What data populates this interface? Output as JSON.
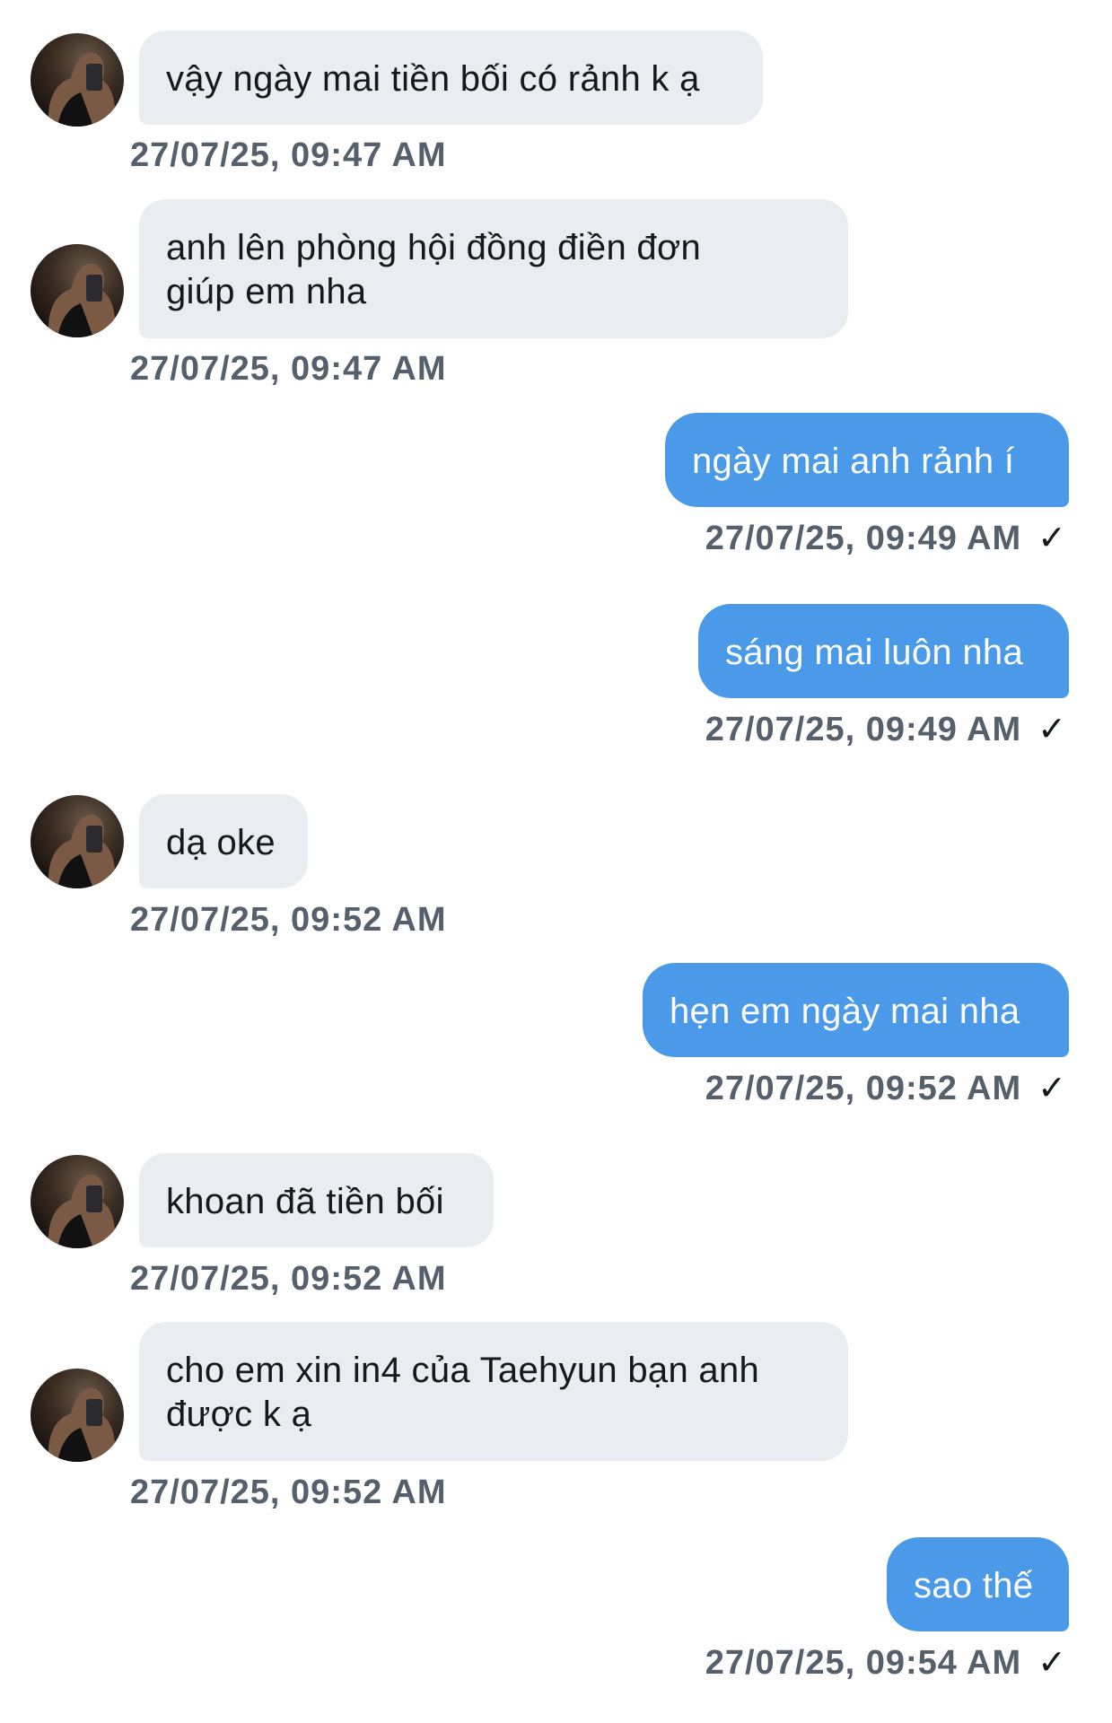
{
  "messages": [
    {
      "side": "in",
      "text": "vậy ngày mai tiền bối có rảnh k ạ",
      "time": "27/07/25, 09:47 AM"
    },
    {
      "side": "in",
      "text": "anh lên phòng hội đồng điền đơn\ngiúp em nha",
      "time": "27/07/25, 09:47 AM"
    },
    {
      "side": "out",
      "text": "ngày mai anh rảnh í",
      "time": "27/07/25, 09:49 AM",
      "status_icon": "checkmark-icon",
      "status_glyph": "✓"
    },
    {
      "side": "out",
      "text": "sáng mai luôn nha",
      "time": "27/07/25, 09:49 AM",
      "status_icon": "checkmark-icon",
      "status_glyph": "✓"
    },
    {
      "side": "in",
      "text": "dạ oke",
      "time": "27/07/25, 09:52 AM"
    },
    {
      "side": "out",
      "text": "hẹn em ngày mai nha",
      "time": "27/07/25, 09:52 AM",
      "status_icon": "checkmark-icon",
      "status_glyph": "✓"
    },
    {
      "side": "in",
      "text": "khoan đã tiền bối",
      "time": "27/07/25, 09:52 AM"
    },
    {
      "side": "in",
      "text": "cho em xin in4 của Taehyun bạn anh\nđược k ạ",
      "time": "27/07/25, 09:52 AM"
    },
    {
      "side": "out",
      "text": "sao thế",
      "time": "27/07/25, 09:54 AM",
      "status_icon": "checkmark-icon",
      "status_glyph": "✓"
    }
  ],
  "colors": {
    "incoming_bubble": "#e9ecf0",
    "outgoing_bubble": "#4a9ae9",
    "timestamp": "#55606c"
  }
}
